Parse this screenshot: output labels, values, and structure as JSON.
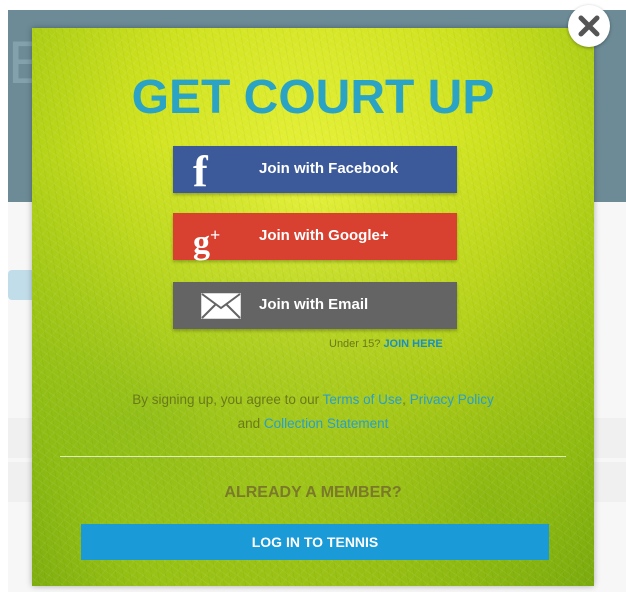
{
  "background": {
    "header_letter": "E"
  },
  "modal": {
    "title": "GET COURT UP",
    "buttons": {
      "facebook": {
        "label": "Join with Facebook",
        "icon": "facebook-icon",
        "color": "#3c5a9a"
      },
      "google": {
        "label": "Join with Google+",
        "icon": "google-plus-icon",
        "color": "#d84130"
      },
      "email": {
        "label": "Join with Email",
        "icon": "mail-icon",
        "color": "#646464"
      }
    },
    "under15": {
      "text": "Under 15?",
      "link": "JOIN HERE"
    },
    "terms": {
      "prefix": "By signing up, you agree to our",
      "terms_link": "Terms of Use",
      "separator": ",",
      "privacy_link": "Privacy Policy",
      "and_text": "and",
      "collection_link": "Collection Statement"
    },
    "member_heading": "ALREADY A MEMBER?",
    "login_button": {
      "label": "LOG IN TO TENNIS",
      "color": "#1a9ad6"
    },
    "title_color": "#2aa3c4"
  },
  "close": {
    "icon": "close-icon"
  }
}
